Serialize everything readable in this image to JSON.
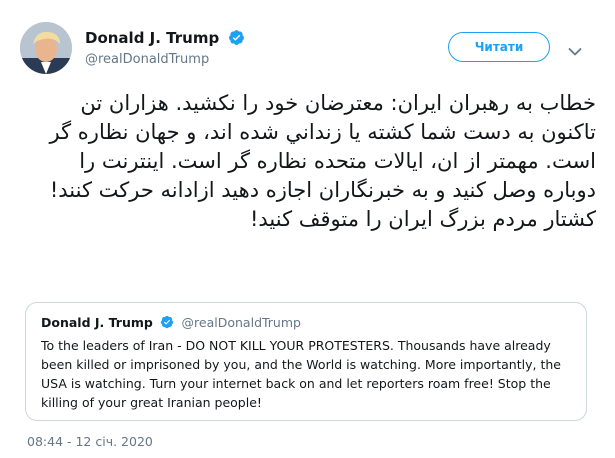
{
  "author": {
    "name": "Donald J. Trump",
    "handle": "@realDonaldTrump"
  },
  "follow_button_label": "Читати",
  "tweet_text": "خطاب به رهبران ایران: معترضان خود را نکشید. هزاران تن تاکنون به دست شما کشته يا زنداني شده اند، و جهان نظاره گر است. مهمتر از ان، ایالات متحده نظاره گر است. اینترنت را دوباره وصل کنید و به خبرنگاران اجازه دهید ازادانه حرکت کنند! کشتار مردم بزرگ ایران را متوقف کنید!",
  "quoted_tweet": {
    "name": "Donald J. Trump",
    "handle": "@realDonaldTrump",
    "text": "To the leaders of Iran - DO NOT KILL YOUR PROTESTERS. Thousands have already been killed or imprisoned by you, and the World is watching. More importantly, the USA is watching. Turn your internet back on and let reporters roam free! Stop the killing of your great Iranian people!"
  },
  "timestamp": "08:44 - 12 січ. 2020",
  "icons": {
    "verified": "verified-badge-icon",
    "more": "chevron-down-icon"
  },
  "colors": {
    "accent": "#1da1f2",
    "secondary_text": "#657786",
    "border": "#ccd6dd"
  }
}
